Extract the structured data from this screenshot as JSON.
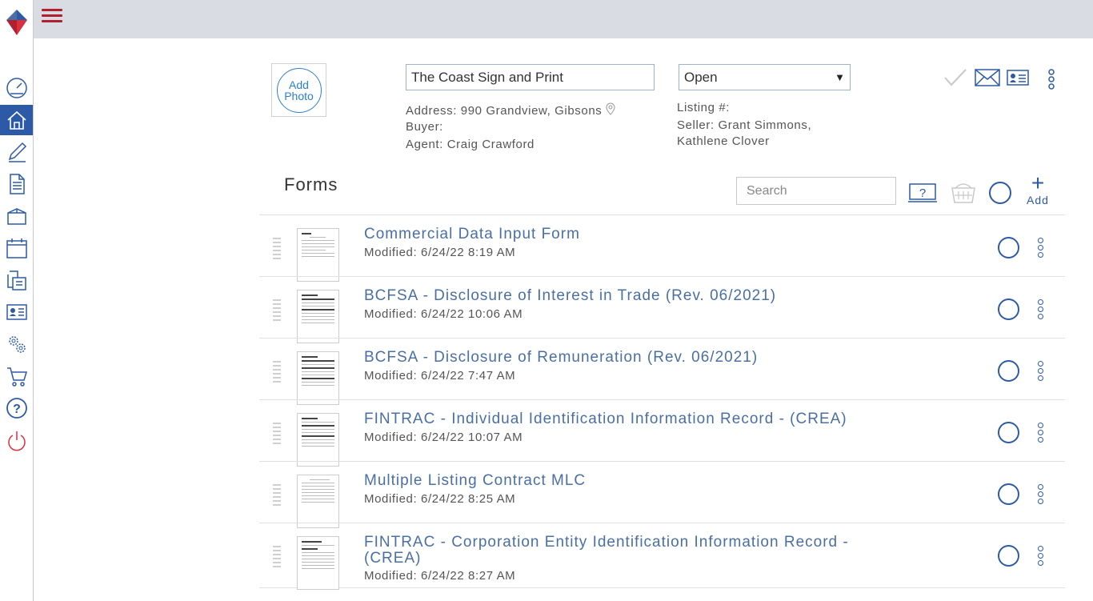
{
  "topbar": {
    "menu_icon": "hamburger-icon"
  },
  "sidebar": {
    "items": [
      {
        "name": "dashboard",
        "icon": "speedometer-icon"
      },
      {
        "name": "home",
        "icon": "home-icon",
        "active": true
      },
      {
        "name": "edit",
        "icon": "pen-icon"
      },
      {
        "name": "documents",
        "icon": "document-icon"
      },
      {
        "name": "box",
        "icon": "box-icon"
      },
      {
        "name": "calendar",
        "icon": "calendar-icon"
      },
      {
        "name": "print",
        "icon": "printer-icon"
      },
      {
        "name": "contacts",
        "icon": "contact-card-icon"
      },
      {
        "name": "settings",
        "icon": "gears-icon"
      },
      {
        "name": "cart",
        "icon": "cart-icon"
      },
      {
        "name": "help",
        "icon": "help-icon"
      },
      {
        "name": "logout",
        "icon": "power-icon"
      }
    ]
  },
  "listing": {
    "photo_label_line1": "Add",
    "photo_label_line2": "Photo",
    "name": "The Coast Sign and Print",
    "address": "Address: 990 Grandview, Gibsons",
    "buyer": "Buyer:",
    "agent": "Agent: Craig Crawford",
    "status": "Open",
    "listing_no": "Listing #:",
    "seller_line1": "Seller: Grant Simmons,",
    "seller_line2": "Kathlene Clover"
  },
  "forms": {
    "title": "Forms",
    "search_placeholder": "Search",
    "add_label": "Add",
    "items": [
      {
        "title": "Commercial Data Input Form",
        "modified": "Modified: 6/24/22 8:19 AM"
      },
      {
        "title": "BCFSA - Disclosure of Interest in Trade (Rev. 06/2021)",
        "modified": "Modified: 6/24/22 10:06 AM"
      },
      {
        "title": "BCFSA - Disclosure of Remuneration (Rev. 06/2021)",
        "modified": "Modified: 6/24/22 7:47 AM"
      },
      {
        "title": "FINTRAC - Individual Identification Information Record - (CREA)",
        "modified": "Modified: 6/24/22 10:07 AM"
      },
      {
        "title": "Multiple Listing Contract MLC",
        "modified": "Modified: 6/24/22 8:25 AM"
      },
      {
        "title": "FINTRAC - Corporation Entity Identification Information Record - (CREA)",
        "modified": "Modified: 6/24/22 8:27 AM"
      }
    ]
  },
  "colors": {
    "accent": "#2d5aa6",
    "brand_red": "#b02030",
    "link": "#4a6fa5"
  }
}
